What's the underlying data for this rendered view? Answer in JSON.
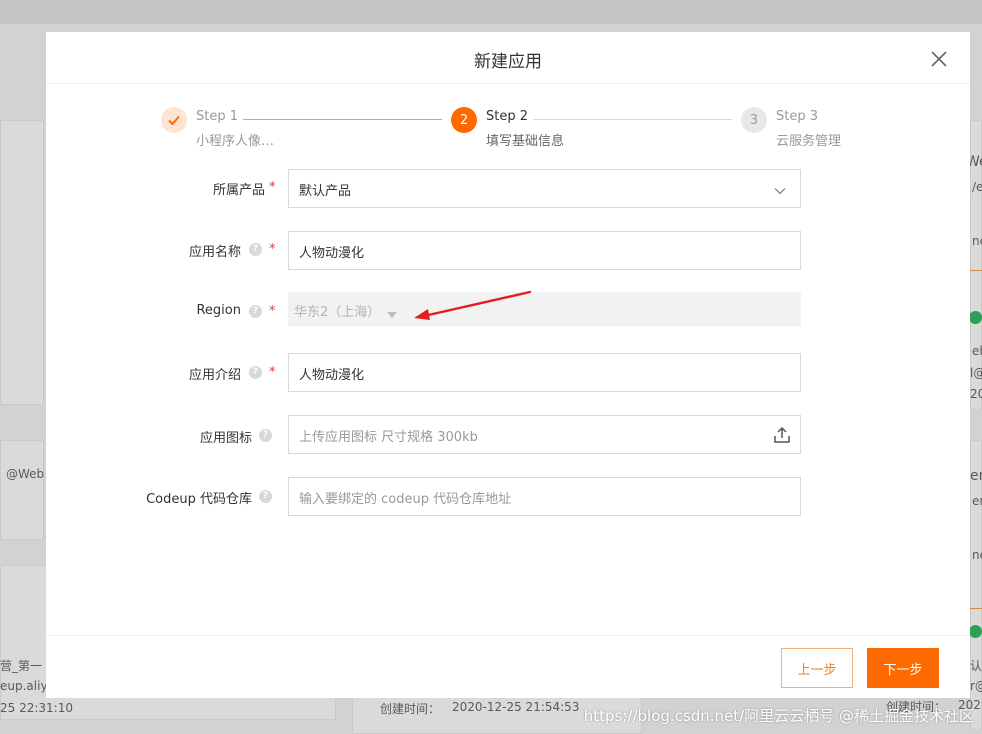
{
  "modal": {
    "title": "新建应用",
    "steps": [
      {
        "number": "✓",
        "title": "Step 1",
        "description": "小程序人像…",
        "status": "done"
      },
      {
        "number": "2",
        "title": "Step 2",
        "description": "填写基础信息",
        "status": "active"
      },
      {
        "number": "3",
        "title": "Step 3",
        "description": "云服务管理",
        "status": "pending"
      }
    ],
    "form": {
      "product": {
        "label": "所属产品",
        "value": "默认产品"
      },
      "app_name": {
        "label": "应用名称",
        "value": "人物动漫化"
      },
      "region": {
        "label": "Region",
        "value": "华东2（上海）"
      },
      "app_intro": {
        "label": "应用介绍",
        "value": "人物动漫化"
      },
      "app_icon": {
        "label": "应用图标",
        "placeholder": "上传应用图标 尺寸规格 300kb"
      },
      "codeup": {
        "label": "Codeup 代码仓库",
        "placeholder": "输入要绑定的 codeup 代码仓库地址"
      }
    },
    "required_mark": "*",
    "help_mark": "?",
    "footer": {
      "prev_label": "上一步",
      "next_label": "下一步"
    }
  },
  "background": {
    "left_texts": [
      "@Web",
      "营_第一",
      "eup.aliyu",
      "25 22:31:10"
    ],
    "bottom_created": {
      "label": "创建时间：",
      "value": "2020-12-25 21:54:53"
    },
    "right_texts": [
      "We",
      "/e",
      "ne",
      "eb",
      "l@",
      "20",
      "en",
      "en",
      "ne",
      "认",
      "r@",
      "创建时间：",
      "202"
    ]
  },
  "watermark": "https://blog.csdn.net/阿里云云栖号 @稀土掘金技术社区",
  "colors": {
    "accent": "#ff6a00",
    "done_circle_bg": "#fde5d3",
    "pending_circle_bg": "#e8e8e8",
    "required": "#e23c3c",
    "annotation_arrow": "#e02020"
  },
  "icons": [
    "check-icon",
    "close-icon",
    "chevron-down-icon",
    "caret-down-icon",
    "upload-icon",
    "help-icon",
    "annotation-arrow-icon"
  ]
}
